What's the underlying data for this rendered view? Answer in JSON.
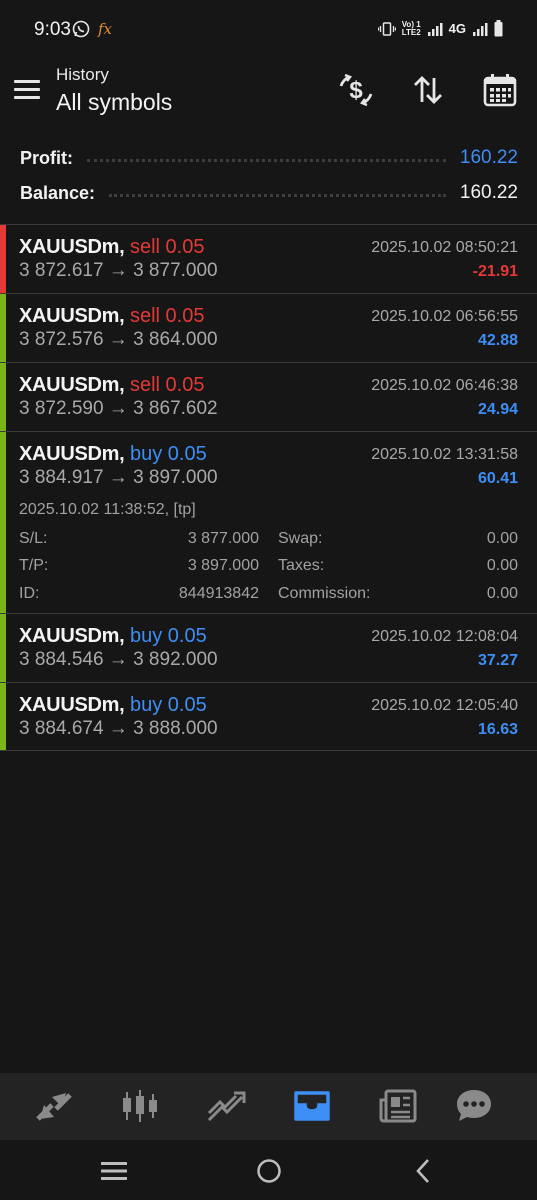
{
  "status_bar": {
    "time": "9:03",
    "network_lte_top": "Vo) 1",
    "network_lte_bottom": "LTE2",
    "network_4g": "4G"
  },
  "header": {
    "subtitle": "History",
    "title": "All symbols"
  },
  "summary": {
    "profit_label": "Profit:",
    "profit_value": "160.22",
    "balance_label": "Balance:",
    "balance_value": "160.22"
  },
  "deals": [
    {
      "symbol": "XAUUSDm,",
      "type": "sell 0.05",
      "prices": "3 872.617 → 3 877.000",
      "time": "2025.10.02 08:50:21",
      "profit": "-21.91"
    },
    {
      "symbol": "XAUUSDm,",
      "type": "sell 0.05",
      "prices": "3 872.576 → 3 864.000",
      "time": "2025.10.02 06:56:55",
      "profit": "42.88"
    },
    {
      "symbol": "XAUUSDm,",
      "type": "sell 0.05",
      "prices": "3 872.590 → 3 867.602",
      "time": "2025.10.02 06:46:38",
      "profit": "24.94"
    },
    {
      "symbol": "XAUUSDm,",
      "type": "buy 0.05",
      "prices": "3 884.917 → 3 897.000",
      "time": "2025.10.02 13:31:58",
      "profit": "60.41"
    },
    {
      "symbol": "XAUUSDm,",
      "type": "buy 0.05",
      "prices": "3 884.546 → 3 892.000",
      "time": "2025.10.02 12:08:04",
      "profit": "37.27"
    },
    {
      "symbol": "XAUUSDm,",
      "type": "buy 0.05",
      "prices": "3 884.674 → 3 888.000",
      "time": "2025.10.02 12:05:40",
      "profit": "16.63"
    }
  ],
  "expanded_details": {
    "open_info": "2025.10.02 11:38:52, [tp]",
    "sl_label": "S/L:",
    "sl_value": "3 877.000",
    "tp_label": "T/P:",
    "tp_value": "3 897.000",
    "id_label": "ID:",
    "id_value": "844913842",
    "swap_label": "Swap:",
    "swap_value": "0.00",
    "taxes_label": "Taxes:",
    "taxes_value": "0.00",
    "commission_label": "Commission:",
    "commission_value": "0.00"
  },
  "colors": {
    "accent_blue": "#3d8ef5",
    "loss_red": "#e53935",
    "win_green": "#7cb518",
    "background": "#161616"
  },
  "icons": {
    "header": [
      "dollar-exchange-icon",
      "sort-icon",
      "calendar-icon"
    ],
    "bottom_nav": [
      "quotes-icon",
      "chart-icon",
      "trade-icon",
      "history-icon",
      "news-icon",
      "chat-icon"
    ],
    "bottom_nav_active": "history-icon",
    "system_nav": [
      "recent-apps-icon",
      "home-icon",
      "back-icon"
    ]
  }
}
